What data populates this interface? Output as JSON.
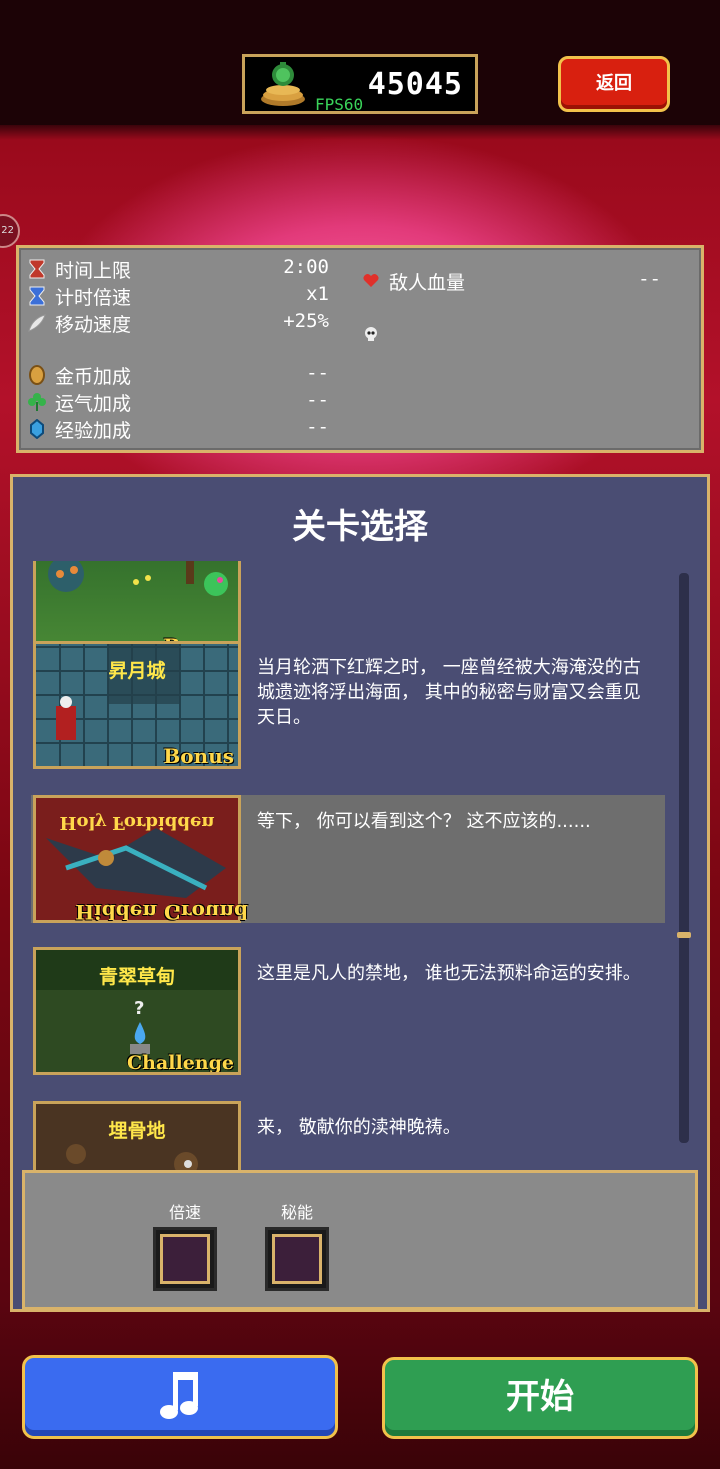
{
  "header": {
    "coins": "45045",
    "fps": "FPS60",
    "back_label": "返回"
  },
  "side_nub": "22",
  "stats": {
    "left": [
      {
        "label": "时间上限",
        "value": "2:00",
        "icon": "hourglass-red-icon"
      },
      {
        "label": "计时倍速",
        "value": "x1",
        "icon": "hourglass-blue-icon"
      },
      {
        "label": "移动速度",
        "value": "+25%",
        "icon": "wing-icon"
      },
      {
        "label": "金币加成",
        "value": "--",
        "icon": "coin-icon"
      },
      {
        "label": "运气加成",
        "value": "--",
        "icon": "clover-icon"
      },
      {
        "label": "经验加成",
        "value": "--",
        "icon": "gem-icon"
      }
    ],
    "right": [
      {
        "label": "敌人血量",
        "value": "--",
        "icon": "heart-icon"
      }
    ]
  },
  "stage_select": {
    "title": "关卡选择",
    "items": [
      {
        "name": "",
        "tag": "Bonus",
        "desc": ""
      },
      {
        "name": "昇月城",
        "tag": "Bonus",
        "desc": "当月轮洒下红辉之时， 一座曾经被大海淹没的古城遗迹将浮出海面， 其中的秘密与财富又会重见天日。"
      },
      {
        "name": "Holy Forbidden",
        "tag": "Hidden Ground",
        "desc": "等下， 你可以看到这个？ 这不应该的......"
      },
      {
        "name": "青翠草甸",
        "tag": "Challenge",
        "desc": "这里是凡人的禁地， 谁也无法预料命运的安排。"
      },
      {
        "name": "埋骨地",
        "tag": "",
        "desc": "来， 敬献你的渎神晚祷。"
      }
    ]
  },
  "options": {
    "speed_label": "倍速",
    "arcana_label": "秘能"
  },
  "buttons": {
    "music_icon": "music-note-icon",
    "start_label": "开始"
  },
  "colors": {
    "panel_gold": "#d9b36a",
    "start_green": "#2f9e52",
    "music_blue": "#3a6bf0",
    "back_red": "#d8200f"
  }
}
